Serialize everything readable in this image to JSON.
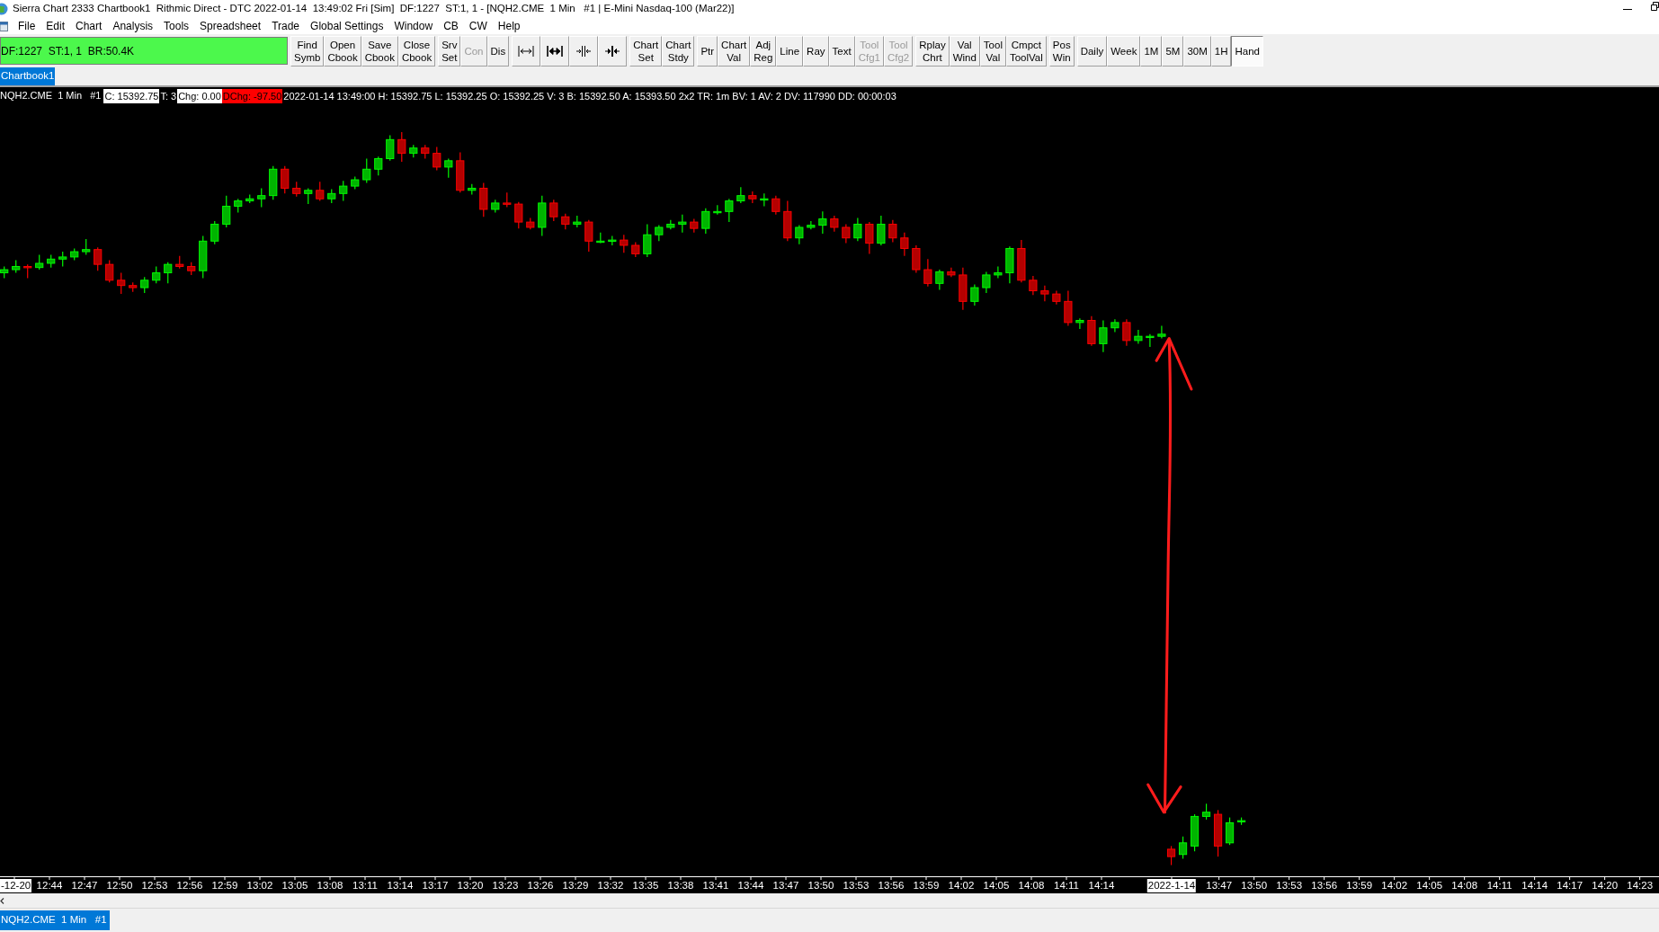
{
  "window": {
    "title": "Sierra Chart 2333 Chartbook1  Rithmic Direct - DTC 2022-01-14  13:49:02 Fri [Sim]  DF:1227  ST:1, 1 - [NQH2.CME  1 Min   #1 | E-Mini Nasdaq-100 (Mar22)]"
  },
  "menu": [
    "File",
    "Edit",
    "Chart",
    "Analysis",
    "Tools",
    "Spreadsheet",
    "Trade",
    "Global Settings",
    "Window",
    "CB",
    "CW",
    "Help"
  ],
  "toolbar": {
    "status": "DF:1227  ST:1, 1  BR:50.4K",
    "groups": [
      [
        {
          "kind": "text",
          "lines": [
            "Find",
            "Symb"
          ],
          "disabled": false,
          "pressed": false
        },
        {
          "kind": "text",
          "lines": [
            "Open",
            "Cbook"
          ],
          "disabled": false,
          "pressed": false
        },
        {
          "kind": "text",
          "lines": [
            "Save",
            "Cbook"
          ],
          "disabled": false,
          "pressed": false
        },
        {
          "kind": "text",
          "lines": [
            "Close",
            "Cbook"
          ],
          "disabled": false,
          "pressed": false
        }
      ],
      [
        {
          "kind": "text",
          "lines": [
            "Srv",
            "Set"
          ],
          "disabled": false,
          "pressed": false
        },
        {
          "kind": "text",
          "lines": [
            "Con"
          ],
          "disabled": true,
          "pressed": false
        },
        {
          "kind": "text",
          "lines": [
            "Dis"
          ],
          "disabled": false,
          "pressed": false
        }
      ],
      [
        {
          "kind": "icon",
          "disabled": false,
          "pressed": false
        },
        {
          "kind": "icon",
          "disabled": false,
          "pressed": false
        },
        {
          "kind": "icon",
          "disabled": false,
          "pressed": false
        },
        {
          "kind": "icon",
          "disabled": false,
          "pressed": false
        }
      ],
      [
        {
          "kind": "text",
          "lines": [
            "Chart",
            "Set"
          ],
          "disabled": false,
          "pressed": false
        },
        {
          "kind": "text",
          "lines": [
            "Chart",
            "Stdy"
          ],
          "disabled": false,
          "pressed": false
        }
      ],
      [
        {
          "kind": "text",
          "lines": [
            "Ptr"
          ],
          "disabled": false,
          "pressed": false
        },
        {
          "kind": "text",
          "lines": [
            "Chart",
            "Val"
          ],
          "disabled": false,
          "pressed": false
        },
        {
          "kind": "text",
          "lines": [
            "Adj",
            "Reg"
          ],
          "disabled": false,
          "pressed": false
        },
        {
          "kind": "text",
          "lines": [
            "Line"
          ],
          "disabled": false,
          "pressed": false
        },
        {
          "kind": "text",
          "lines": [
            "Ray"
          ],
          "disabled": false,
          "pressed": false
        },
        {
          "kind": "text",
          "lines": [
            "Text"
          ],
          "disabled": false,
          "pressed": false
        },
        {
          "kind": "text",
          "lines": [
            "Tool",
            "Cfg1"
          ],
          "disabled": true,
          "pressed": false
        },
        {
          "kind": "text",
          "lines": [
            "Tool",
            "Cfg2"
          ],
          "disabled": true,
          "pressed": false
        }
      ],
      [
        {
          "kind": "text",
          "lines": [
            "Rplay",
            "Chrt"
          ],
          "disabled": false,
          "pressed": false
        },
        {
          "kind": "text",
          "lines": [
            "Val",
            "Wind"
          ],
          "disabled": false,
          "pressed": false
        },
        {
          "kind": "text",
          "lines": [
            "Tool",
            "Val"
          ],
          "disabled": false,
          "pressed": false
        },
        {
          "kind": "text",
          "lines": [
            "Cmpct",
            "ToolVal"
          ],
          "disabled": false,
          "pressed": false
        }
      ],
      [
        {
          "kind": "text",
          "lines": [
            "Pos",
            "Win"
          ],
          "disabled": false,
          "pressed": false
        }
      ],
      [
        {
          "kind": "text",
          "lines": [
            "Daily"
          ],
          "disabled": false,
          "pressed": false
        },
        {
          "kind": "text",
          "lines": [
            "Week"
          ],
          "disabled": false,
          "pressed": false
        },
        {
          "kind": "text",
          "lines": [
            "1M"
          ],
          "disabled": false,
          "pressed": false
        },
        {
          "kind": "text",
          "lines": [
            "5M"
          ],
          "disabled": false,
          "pressed": false
        },
        {
          "kind": "text",
          "lines": [
            "30M"
          ],
          "disabled": false,
          "pressed": false
        },
        {
          "kind": "text",
          "lines": [
            "1H"
          ],
          "disabled": false,
          "pressed": false
        },
        {
          "kind": "text",
          "lines": [
            "Hand"
          ],
          "disabled": false,
          "pressed": true
        }
      ]
    ]
  },
  "chartbook_tabs": [
    {
      "label": "Chartbook1",
      "selected": true
    }
  ],
  "quote_line": {
    "symbol": "NQH2.CME  1 Min   #1",
    "fields": [
      {
        "kind": "boxed",
        "text": "C: 15392.75"
      },
      {
        "kind": "plain",
        "text": "T: 3"
      },
      {
        "kind": "boxed",
        "text": "Chg: 0.00"
      },
      {
        "kind": "alert",
        "text": "DChg: -97.50"
      },
      {
        "kind": "plain",
        "text": "2022-01-14 13:49:00 H: 15392.75 L: 15392.25 O: 15392.25 V: 3 B: 15392.50 A: 15393.50 2x2 TR: 1m BV: 1 AV: 2 DV: 117990 DD: 00:00:03"
      }
    ]
  },
  "time_axis": [
    {
      "kind": "date",
      "label": "-12-20"
    },
    {
      "kind": "time",
      "label": "12:44"
    },
    {
      "kind": "time",
      "label": "12:47"
    },
    {
      "kind": "time",
      "label": "12:50"
    },
    {
      "kind": "time",
      "label": "12:53"
    },
    {
      "kind": "time",
      "label": "12:56"
    },
    {
      "kind": "time",
      "label": "12:59"
    },
    {
      "kind": "time",
      "label": "13:02"
    },
    {
      "kind": "time",
      "label": "13:05"
    },
    {
      "kind": "time",
      "label": "13:08"
    },
    {
      "kind": "time",
      "label": "13:11"
    },
    {
      "kind": "time",
      "label": "13:14"
    },
    {
      "kind": "time",
      "label": "13:17"
    },
    {
      "kind": "time",
      "label": "13:20"
    },
    {
      "kind": "time",
      "label": "13:23"
    },
    {
      "kind": "time",
      "label": "13:26"
    },
    {
      "kind": "time",
      "label": "13:29"
    },
    {
      "kind": "time",
      "label": "13:32"
    },
    {
      "kind": "time",
      "label": "13:35"
    },
    {
      "kind": "time",
      "label": "13:38"
    },
    {
      "kind": "time",
      "label": "13:41"
    },
    {
      "kind": "time",
      "label": "13:44"
    },
    {
      "kind": "time",
      "label": "13:47"
    },
    {
      "kind": "time",
      "label": "13:50"
    },
    {
      "kind": "time",
      "label": "13:53"
    },
    {
      "kind": "time",
      "label": "13:56"
    },
    {
      "kind": "time",
      "label": "13:59"
    },
    {
      "kind": "time",
      "label": "14:02"
    },
    {
      "kind": "time",
      "label": "14:05"
    },
    {
      "kind": "time",
      "label": "14:08"
    },
    {
      "kind": "time",
      "label": "14:11"
    },
    {
      "kind": "time",
      "label": "14:14"
    },
    {
      "kind": "date",
      "label": "2022-1-14"
    },
    {
      "kind": "time",
      "label": "13:47"
    },
    {
      "kind": "time",
      "label": "13:50"
    },
    {
      "kind": "time",
      "label": "13:53"
    },
    {
      "kind": "time",
      "label": "13:56"
    },
    {
      "kind": "time",
      "label": "13:59"
    },
    {
      "kind": "time",
      "label": "14:02"
    },
    {
      "kind": "time",
      "label": "14:05"
    },
    {
      "kind": "time",
      "label": "14:08"
    },
    {
      "kind": "time",
      "label": "14:11"
    },
    {
      "kind": "time",
      "label": "14:14"
    },
    {
      "kind": "time",
      "label": "14:17"
    },
    {
      "kind": "time",
      "label": "14:20"
    },
    {
      "kind": "time",
      "label": "14:23"
    }
  ],
  "chart_tabs": [
    {
      "label": "NQH2.CME  1 Min   #1",
      "selected": true
    }
  ]
}
